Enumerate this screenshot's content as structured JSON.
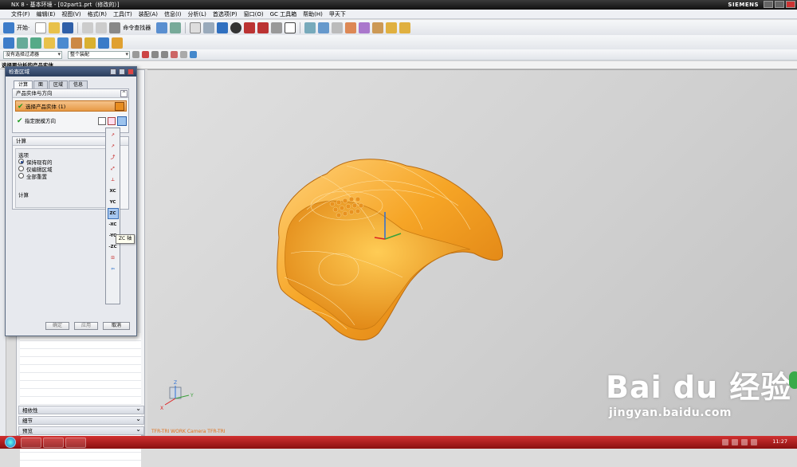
{
  "window": {
    "title": "NX 8 - 基本环境 - [02part1.prt（修改的）]",
    "brand": "SIEMENS"
  },
  "menu": [
    "文件(F)",
    "编辑(E)",
    "视图(V)",
    "格式(R)",
    "工具(T)",
    "装配(A)",
    "信息(I)",
    "分析(L)",
    "首选项(P)",
    "窗口(O)",
    "GC 工具箱",
    "帮助(H)",
    "甲天下"
  ],
  "toolbar": {
    "start_label": "开始·",
    "command_finder": "命令查找器"
  },
  "filter": {
    "type_filter": "没有选择过滤器",
    "scope": "整个装配"
  },
  "status_prompt": "选择要分析的产品实体",
  "dialog": {
    "title": "检查区域",
    "tabs": [
      "计算",
      "面",
      "区域",
      "信息"
    ],
    "section1_title": "产品实体与方向",
    "row_select_body": "选择产品实体 (1)",
    "row_direction": "指定脱模方向",
    "section2_title": "计算",
    "options_title": "选项",
    "options": [
      "保持现有的",
      "仅编辑区域",
      "全部重置"
    ],
    "calc_label": "计算",
    "buttons": {
      "ok": "确定",
      "apply": "应用",
      "cancel": "取消"
    }
  },
  "vector_menu": {
    "items": [
      "XC",
      "YC",
      "ZC",
      "-XC",
      "-YC",
      "-ZC"
    ],
    "tooltip": "ZC 轴"
  },
  "nav_sections": [
    "相依性",
    "细节",
    "预览"
  ],
  "viewport": {
    "info": "TFR-TRI WORK Camera TFR-TRI",
    "triad_axes": [
      "X",
      "Y",
      "Z"
    ]
  },
  "watermark": {
    "brand": "Bai du 经验",
    "url": "jingyan.baidu.com"
  },
  "taskbar": {
    "clock": "11:27"
  },
  "colors": {
    "part": "#f5a623",
    "title_bar": "#1a1a1a",
    "taskbar": "#b01c1c"
  }
}
